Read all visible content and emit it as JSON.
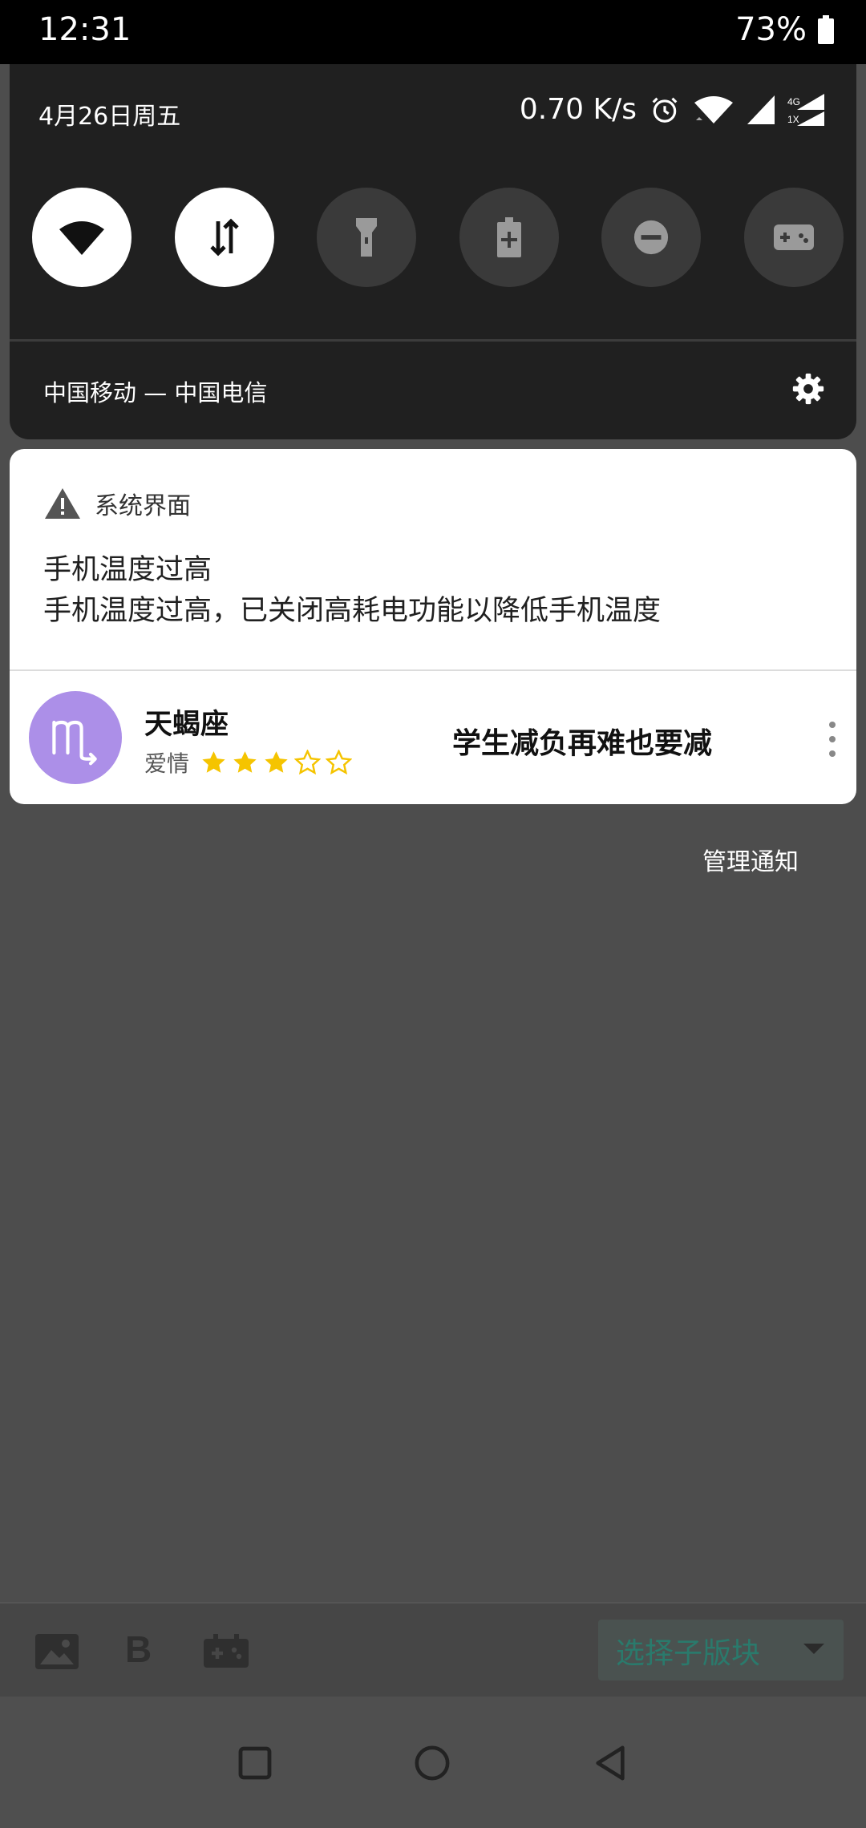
{
  "status_bar": {
    "time": "12:31",
    "battery": "73%",
    "icons": [
      "battery-icon"
    ]
  },
  "quick_settings": {
    "date": "4月26日周五",
    "net_speed": "0.70 K/s",
    "status_icons": [
      "alarm-icon",
      "wifi-signal-icon",
      "cellular-signal-icon",
      "4g-1x-signal-icon"
    ],
    "signal_labels": {
      "top": "4G",
      "bottom": "1X"
    },
    "tiles": [
      {
        "name": "wifi",
        "state": "on",
        "icon": "wifi-icon"
      },
      {
        "name": "mobile-data",
        "state": "on",
        "icon": "data-arrows-icon"
      },
      {
        "name": "flashlight",
        "state": "off",
        "icon": "flashlight-icon"
      },
      {
        "name": "battery-saver",
        "state": "off",
        "icon": "battery-saver-icon"
      },
      {
        "name": "do-not-disturb",
        "state": "off",
        "icon": "dnd-icon"
      },
      {
        "name": "game-mode",
        "state": "off",
        "icon": "gamepad-icon"
      }
    ],
    "carrier": "中国移动 — 中国电信",
    "settings_icon": "gear-icon"
  },
  "notifications": {
    "system": {
      "app_name": "系统界面",
      "icon": "warning-icon",
      "title": "手机温度过高",
      "text": "手机温度过高，已关闭高耗电功能以降低手机温度"
    },
    "horoscope": {
      "icon": "scorpio-icon",
      "name": "天蝎座",
      "label": "爱情",
      "rating": 3,
      "rating_max": 5,
      "headline": "学生减负再难也要减",
      "more_icon": "more-vert-icon"
    }
  },
  "manage_label": "管理通知",
  "app_toolbar": {
    "icons": [
      "image-icon",
      "bold-icon",
      "gamepad-icon"
    ],
    "bold_glyph": "B",
    "subforum_label": "选择子版块"
  },
  "nav_bar": {
    "buttons": [
      "recents-button",
      "home-button",
      "back-button"
    ]
  },
  "colors": {
    "panel": "#202020",
    "tile_on": "#ffffff",
    "tile_off": "#3a3a3a",
    "card": "#ffffff",
    "avatar": "#ac8fe8",
    "star": "#f5c400",
    "scrim": "#4d4d4d",
    "accent_text": "#2a7a6c"
  }
}
